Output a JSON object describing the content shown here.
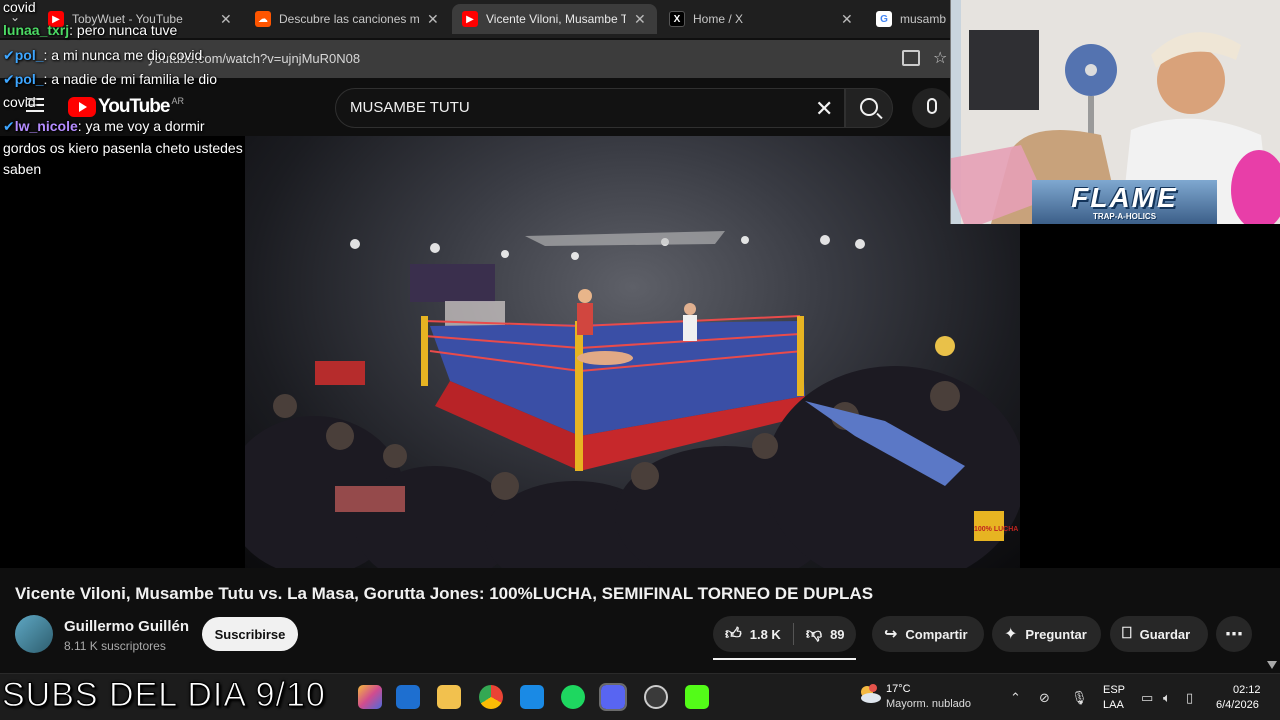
{
  "browser": {
    "tabs": [
      {
        "label": "TobyWuet - YouTube",
        "icon": "youtube-icon",
        "color": "#ff0000"
      },
      {
        "label": "Descubre las canciones más",
        "icon": "soundcloud-icon",
        "color": "#ff5500"
      },
      {
        "label": "Vicente Viloni, Musambe Tu",
        "icon": "youtube-icon",
        "color": "#ff0000",
        "active": true
      },
      {
        "label": "Home / X",
        "icon": "x-icon",
        "color": "#000000"
      },
      {
        "label": "musambe",
        "icon": "google-icon",
        "color": "#4285f4"
      }
    ],
    "url": "youtube.com/watch?v=ujnjMuR0N08"
  },
  "youtube": {
    "logo_text": "YouTube",
    "region": "AR",
    "search_value": "MUSAMBE TUTU",
    "video_title": "Vicente Viloni, Musambe Tutu vs. La Masa, Gorutta Jones: 100%LUCHA, SEMIFINAL TORNEO DE DUPLAS",
    "channel_name": "Guillermo Guillén",
    "subscribers": "8.11 K suscriptores",
    "subscribe_label": "Suscribirse",
    "likes": "1.8 K",
    "dislikes": "89",
    "share_label": "Compartir",
    "ask_label": "Preguntar",
    "save_label": "Guardar"
  },
  "chat": [
    {
      "user": "",
      "text": "covid",
      "color": "#ffffff"
    },
    {
      "user": "lunaa_txrj",
      "text": ": pero nunca tuve",
      "color": "#4cd964"
    },
    {
      "user": "pol_",
      "text": ": a mi nunca me dio covid",
      "color": "#3ea6ff"
    },
    {
      "user": "pol_",
      "text": ": a nadie de mi familia le dio",
      "color": "#3ea6ff"
    },
    {
      "user": "",
      "text": "covid",
      "color": "#ffffff"
    },
    {
      "user": "lw_nicole",
      "text": ": ya me voy a dormir",
      "color": "#b48cff"
    },
    {
      "user": "",
      "text": "gordos os kiero pasenla cheto ustedes",
      "color": "#ffffff"
    },
    {
      "user": "",
      "text": "saben",
      "color": "#ffffff"
    }
  ],
  "webcam": {
    "banner_text": "FLAME",
    "banner_sub": "TRAP-A-HOLICS"
  },
  "video_watermark": "100% LUCHA",
  "overlay_text": "SUBS DEL DIA 9/10",
  "taskbar": {
    "weather_temp": "17°C",
    "weather_desc": "Mayorm. nublado",
    "weather_badge": "1",
    "lang_top": "ESP",
    "lang_bottom": "LAA",
    "time": "02:12",
    "date": "6/4/2026"
  }
}
